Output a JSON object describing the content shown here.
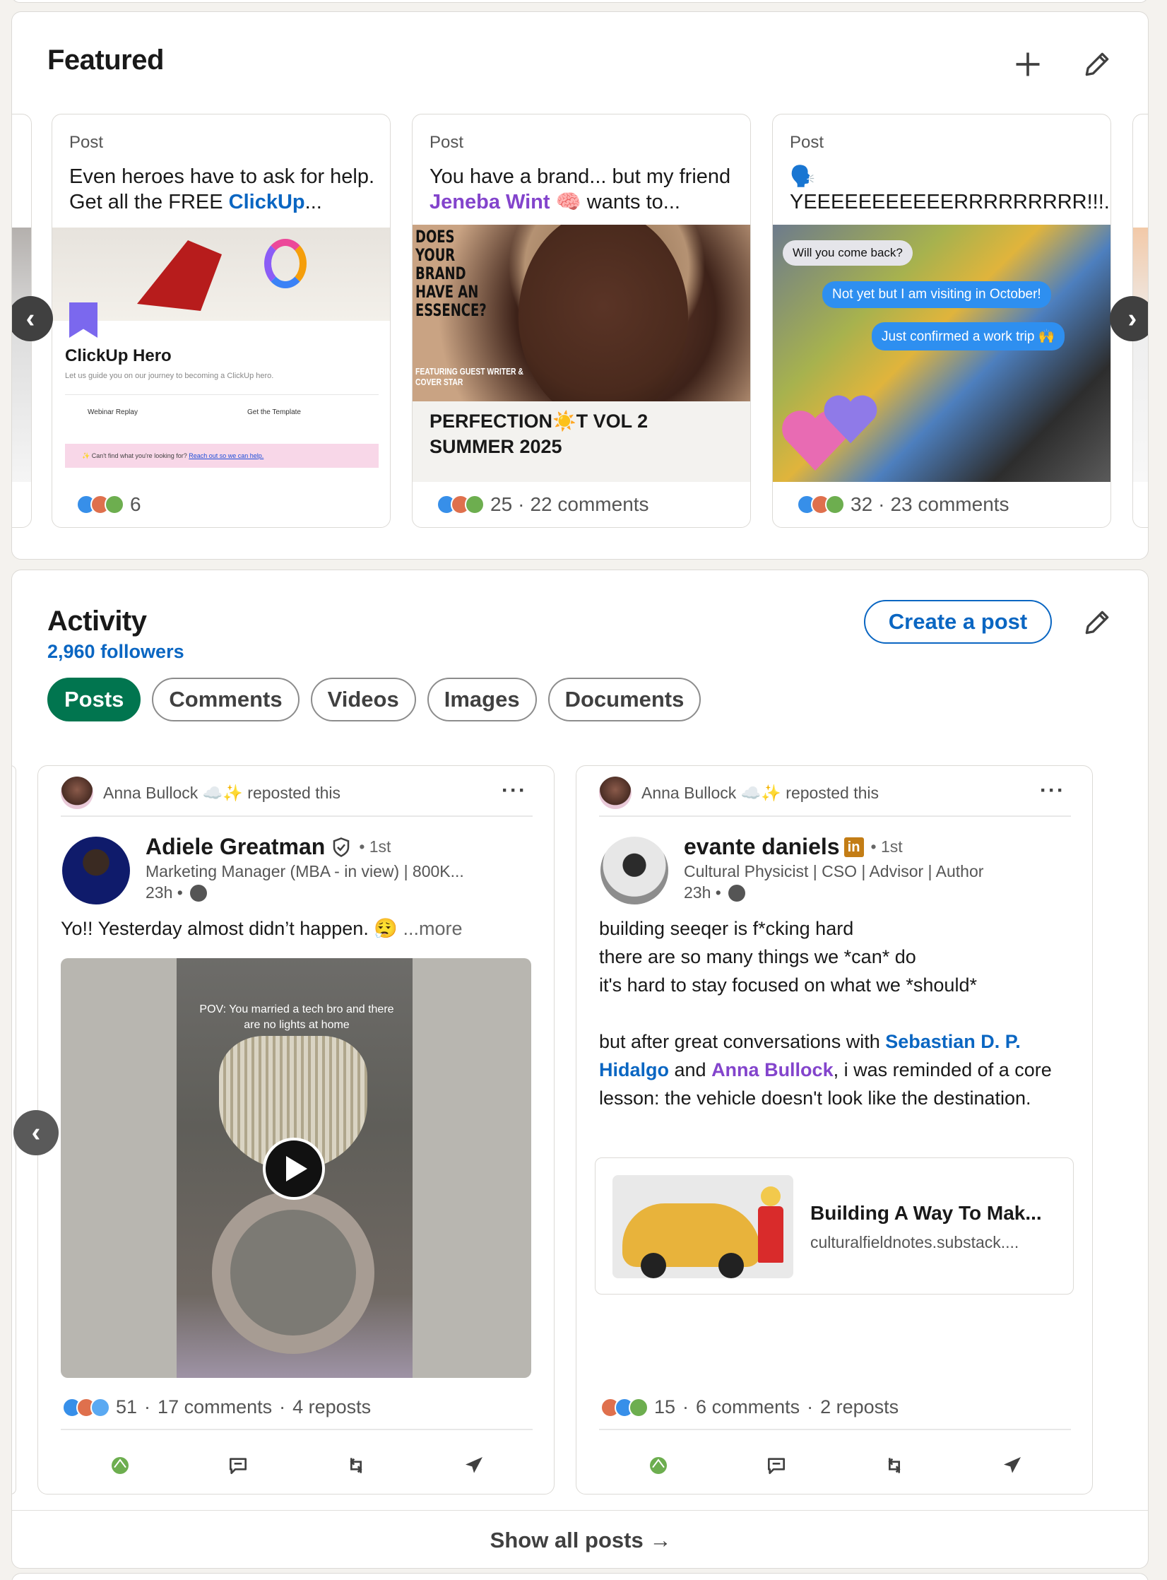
{
  "featured": {
    "title": "Featured",
    "add_icon": "plus-icon",
    "edit_icon": "pencil-icon",
    "prev_icon": "chevron-left-icon",
    "next_icon": "chevron-right-icon",
    "items": [
      {
        "type": "Post",
        "text_a": "Even heroes have to ask for help. Get all the FREE ",
        "text_link": "ClickUp",
        "text_b": "...",
        "img_title": "ClickUp Hero",
        "img_sub": "Let us guide you on our journey to becoming a ClickUp hero.",
        "img_link_1": "Webinar Replay",
        "img_link_2": "Get the Template",
        "img_footer_a": "✨ Can't find what you're looking for? ",
        "img_footer_link": "Reach out so we can help.",
        "reactions": "6"
      },
      {
        "type": "Post",
        "text_a": "You have a brand... but my friend ",
        "text_link": "Jeneba Wint",
        "text_b": " 🧠 wants to...",
        "img_headline": "DOES YOUR BRAND HAVE AN ESSENCE?",
        "img_featuring": "FEATURING GUEST WRITER & COVER STAR",
        "caption": "PERFECTION☀️T VOL 2\nSUMMER 2025",
        "reactions": "25",
        "comments": "22 comments"
      },
      {
        "type": "Post",
        "text_a": "🗣️ YEEEEEEEEEEERRRRRRRRR!!!...",
        "bubble_1": "Will you come back?",
        "bubble_2": "Not yet but I am visiting in October!",
        "bubble_3": "Just confirmed a work trip 🙌",
        "reactions": "32",
        "comments": "23 comments"
      }
    ]
  },
  "activity": {
    "title": "Activity",
    "followers": "2,960 followers",
    "create_post": "Create a post",
    "filters": [
      "Posts",
      "Comments",
      "Videos",
      "Images",
      "Documents"
    ],
    "active_filter": "Posts",
    "posts": [
      {
        "reposter": "Anna Bullock ☁️✨ reposted this",
        "author": "Adiele Greatman",
        "degree": "• 1st",
        "headline": "Marketing Manager (MBA - in view) | 800K...",
        "time": "23h •",
        "body": "Yo!! Yesterday almost didn’t happen. 😮‍💨",
        "more": "...more",
        "video_caption": "POV: You married a tech bro and there are no lights at home",
        "reactions": "51",
        "comments": "17 comments",
        "reposts": "4 reposts"
      },
      {
        "reposter": "Anna Bullock ☁️✨ reposted this",
        "author": "evante daniels",
        "degree": "• 1st",
        "headline": "Cultural Physicist | CSO | Advisor | Author",
        "time": "23h •",
        "body_1": "building seeqer is f*cking hard\nthere are so many things we *can* do\nit's hard to stay focused on what we *should*\n\nbut after great conversations with ",
        "mention_1": "Sebastian D. P. Hidalgo",
        "body_2": " and ",
        "mention_2": "Anna Bullock",
        "body_3": ", i was reminded of a core lesson: the vehicle doesn't look like the destination.",
        "link_title": "Building A Way To Mak...",
        "link_domain": "culturalfieldnotes.substack....",
        "reactions": "15",
        "comments": "6 comments",
        "reposts": "2 reposts"
      }
    ],
    "show_all": "Show all posts →"
  },
  "colors": {
    "brand_blue": "#0a66c2",
    "active_green": "#01754f",
    "mention_purple": "#8344cc"
  }
}
